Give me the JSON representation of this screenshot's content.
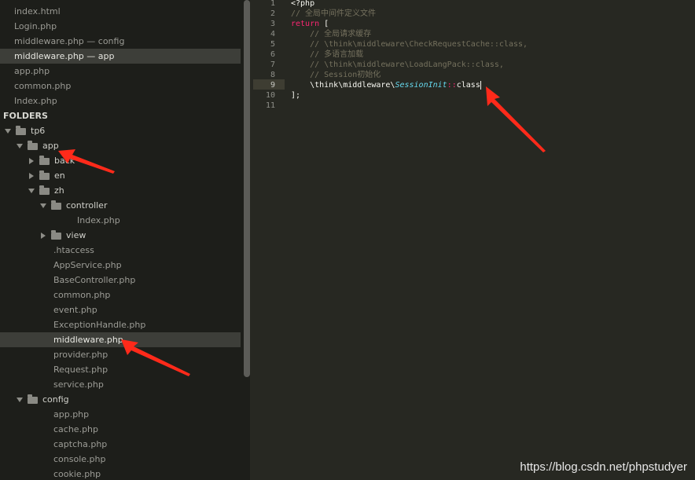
{
  "open_files": [
    {
      "label": "index.html",
      "selected": false
    },
    {
      "label": "Login.php",
      "selected": false
    },
    {
      "label": "middleware.php — config",
      "selected": false
    },
    {
      "label": "middleware.php — app",
      "selected": true
    },
    {
      "label": "app.php",
      "selected": false
    },
    {
      "label": "common.php",
      "selected": false
    },
    {
      "label": "Index.php",
      "selected": false
    }
  ],
  "folders_header": "FOLDERS",
  "tree": [
    {
      "label": "tp6",
      "kind": "folder",
      "state": "open"
    },
    {
      "label": "app",
      "kind": "folder",
      "state": "open"
    },
    {
      "label": "back",
      "kind": "folder",
      "state": "closed"
    },
    {
      "label": "en",
      "kind": "folder",
      "state": "closed"
    },
    {
      "label": "zh",
      "kind": "folder",
      "state": "open"
    },
    {
      "label": "controller",
      "kind": "folder",
      "state": "open"
    },
    {
      "label": "Index.php",
      "kind": "file"
    },
    {
      "label": "view",
      "kind": "folder",
      "state": "closed"
    },
    {
      "label": ".htaccess",
      "kind": "file"
    },
    {
      "label": "AppService.php",
      "kind": "file"
    },
    {
      "label": "BaseController.php",
      "kind": "file"
    },
    {
      "label": "common.php",
      "kind": "file"
    },
    {
      "label": "event.php",
      "kind": "file"
    },
    {
      "label": "ExceptionHandle.php",
      "kind": "file"
    },
    {
      "label": "middleware.php",
      "kind": "file",
      "selected": true
    },
    {
      "label": "provider.php",
      "kind": "file"
    },
    {
      "label": "Request.php",
      "kind": "file"
    },
    {
      "label": "service.php",
      "kind": "file"
    },
    {
      "label": "config",
      "kind": "folder",
      "state": "open"
    },
    {
      "label": "app.php",
      "kind": "file"
    },
    {
      "label": "cache.php",
      "kind": "file"
    },
    {
      "label": "captcha.php",
      "kind": "file"
    },
    {
      "label": "console.php",
      "kind": "file"
    },
    {
      "label": "cookie.php",
      "kind": "file"
    }
  ],
  "editor": {
    "current_line": 9,
    "line_numbers": [
      "1",
      "2",
      "3",
      "4",
      "5",
      "6",
      "7",
      "8",
      "9",
      "10",
      "11"
    ],
    "lines": {
      "l1": "<?php",
      "l2": "// 全局中间件定义文件",
      "l3_kw": "return",
      "l3_rest": " [",
      "l4": "    // 全局请求缓存",
      "l5": "    // \\think\\middleware\\CheckRequestCache::class,",
      "l6": "    // 多语言加载",
      "l7": "    // \\think\\middleware\\LoadLangPack::class,",
      "l8": "    // Session初始化",
      "l9_ns": "    \\think\\middleware\\",
      "l9_cls": "SessionInit",
      "l9_op": "::",
      "l9_tail": "class",
      "l10": "];",
      "l11": ""
    }
  },
  "colors": {
    "sidebar_bg": "#1d1e1a",
    "editor_bg": "#272822",
    "annotation_arrow": "#ff2a1a"
  },
  "watermark": "https://blog.csdn.net/phpstudyer"
}
